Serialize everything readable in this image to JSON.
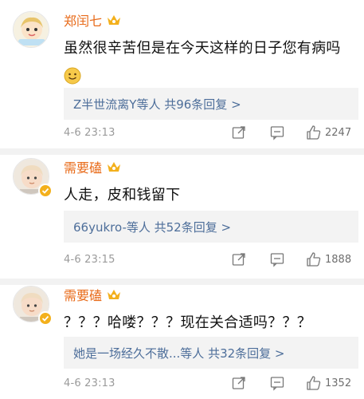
{
  "comments": [
    {
      "username": "郑闰七",
      "text": "虽然很辛苦但是在今天这样的日子您有病吗",
      "has_emoji": true,
      "emoji": "smiley-emoji",
      "replies_label": "Z半世流离Y等人  共96条回复 >",
      "time": "4-6 23:13",
      "likes": "2247"
    },
    {
      "username": "需要磕",
      "text": "人走，皮和钱留下",
      "has_emoji": false,
      "replies_label": "66yukro-等人  共52条回复 >",
      "time": "4-6 23:15",
      "likes": "1888"
    },
    {
      "username": "需要磕",
      "text": "？？？哈喽？？？现在关合适吗？？？",
      "has_emoji": false,
      "replies_label": "她是一场经久不散...等人  共32条回复 >",
      "time": "4-6 23:13",
      "likes": "1352"
    }
  ],
  "colors": {
    "username": "#e86b1a",
    "replies_text": "#4d6e9a",
    "replies_bg": "#f3f3f3",
    "meta_gray": "#9a9a9a",
    "badge": "#f3b01c"
  },
  "icons": [
    "avatar",
    "vip-crown-icon",
    "verified-badge-icon",
    "repost-icon",
    "comment-icon",
    "like-icon"
  ]
}
